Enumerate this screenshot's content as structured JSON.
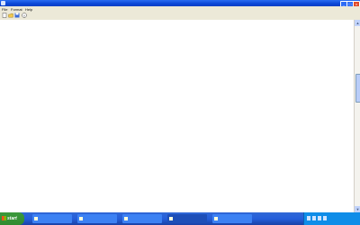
{
  "window": {
    "title": "",
    "minimize": "_",
    "maximize": "□",
    "close": "x"
  },
  "menu": {
    "items": [
      "File",
      "Format",
      "Help"
    ]
  },
  "toolbar": {
    "icons": [
      "new-icon",
      "open-icon",
      "save-icon",
      "info-icon"
    ]
  },
  "table": {
    "rows": [
      {
        "label": "",
        "c1": "",
        "c2": "",
        "c3": ""
      },
      {
        "label": "",
        "c1": "",
        "c2": "",
        "c3": ""
      },
      {
        "label": "",
        "c1": "",
        "c2": "",
        "c3": ""
      },
      {
        "label": "",
        "c1": "",
        "c2": "",
        "c3": ""
      },
      {
        "label": "",
        "c1": "",
        "c2": "",
        "c3": ""
      },
      {
        "label": "",
        "c1": "",
        "c2": "",
        "c3": ""
      },
      {
        "label": "",
        "c1": "",
        "c2": "",
        "c3": ""
      },
      {
        "label": "",
        "c1": "",
        "c2": "",
        "c3": ""
      },
      {
        "label": "",
        "c1": "",
        "c2": "",
        "c3": ""
      },
      {
        "label": "",
        "c1": "",
        "c2": "",
        "c3": ""
      },
      {
        "label": "",
        "c1": "",
        "c2": "",
        "c3": ""
      },
      {
        "label": "",
        "c1": "",
        "c2": "",
        "c3": ""
      },
      {
        "label": "",
        "c1": "",
        "c2": "",
        "c3": ""
      },
      {
        "label": "",
        "c1": "",
        "c2": "",
        "c3": ""
      },
      {
        "label": "",
        "c1": "",
        "c2": "",
        "c3": ""
      },
      {
        "label": "",
        "c1": "",
        "c2": "",
        "c3": ""
      },
      {
        "label": "",
        "c1": "",
        "c2": "",
        "c3": ""
      },
      {
        "label": "",
        "c1": "",
        "c2": "",
        "c3": ""
      },
      {
        "label": "",
        "c1": "",
        "c2": "",
        "c3": ""
      },
      {
        "label": "",
        "c1": "",
        "c2": "",
        "c3": ""
      },
      {
        "label": "",
        "c1": "",
        "c2": "",
        "c3": ""
      },
      {
        "label": "",
        "c1": "",
        "c2": "",
        "c3": ""
      },
      {
        "label": "",
        "c1": "",
        "c2": "",
        "c3": ""
      }
    ]
  },
  "taskbar": {
    "start_label": "start",
    "tasks": [
      "",
      "",
      "",
      "",
      ""
    ],
    "clock": ""
  }
}
